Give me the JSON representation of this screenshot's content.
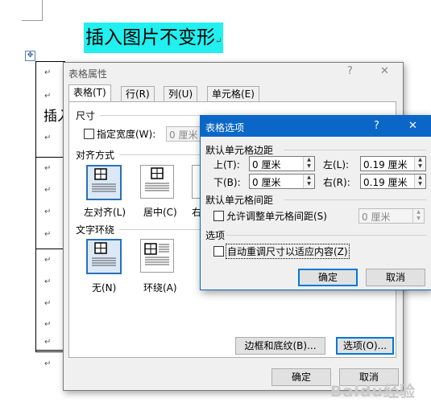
{
  "document": {
    "heading": "插入图片不变形",
    "paragraph_mark": "↵",
    "table_cell_partial": "插入",
    "move_handle_icon": "table-move-handle-icon"
  },
  "table_properties": {
    "title": "表格属性",
    "help": "?",
    "close": "✕",
    "tabs": [
      "表格(T)",
      "行(R)",
      "列(U)",
      "单元格(E)"
    ],
    "size_section": "尺寸",
    "preferred_width_label": "指定宽度(W):",
    "preferred_width_value": "0 厘米",
    "alignment_section": "对齐方式",
    "alignment_options": [
      "左对齐(L)",
      "居中(C)",
      "右"
    ],
    "wrapping_section": "文字环绕",
    "wrapping_options": [
      "无(N)",
      "环绕(A)"
    ],
    "borders_button": "边框和底纹(B)...",
    "options_button": "选项(O)...",
    "ok_button": "确定",
    "cancel_button": "取消"
  },
  "table_options": {
    "title": "表格选项",
    "help": "?",
    "close": "✕",
    "margins_section": "默认单元格边距",
    "top_label": "上(T):",
    "top_value": "0 厘米",
    "left_label": "左(L):",
    "left_value": "0.19 厘米",
    "bottom_label": "下(B):",
    "bottom_value": "0 厘米",
    "right_label": "右(R):",
    "right_value": "0.19 厘米",
    "spacing_section": "默认单元格间距",
    "allow_spacing_label": "允许调整单元格间距(S)",
    "spacing_value": "0 厘米",
    "options_section": "选项",
    "autoresize_label": "自动重调尺寸以适应内容(Z)",
    "autoresize_checked": false,
    "ok_button": "确定",
    "cancel_button": "取消"
  },
  "watermark": "Baidu经验",
  "colors": {
    "highlight": "#22f0f0",
    "dialog_title_blue": "#0b67c7",
    "selected_icon_border": "#2a6fb8"
  }
}
